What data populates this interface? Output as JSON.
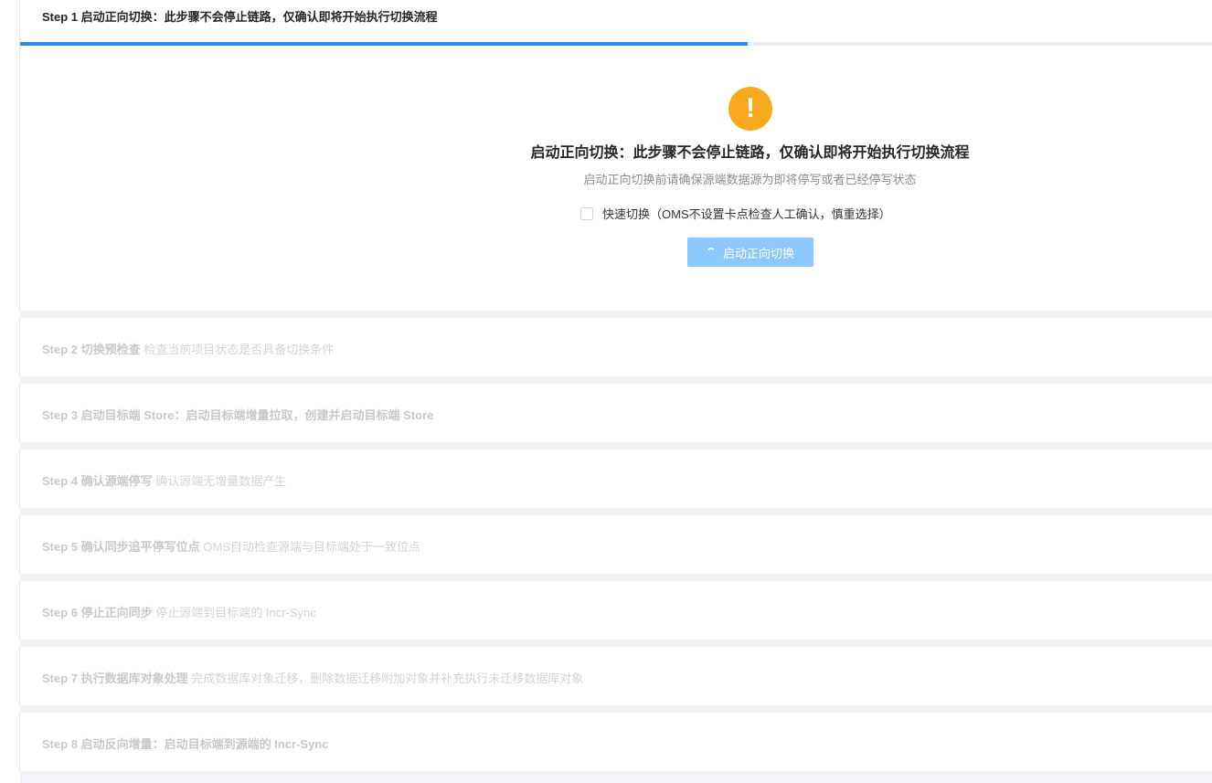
{
  "step1": {
    "header": "Step 1 启动正向切换：此步骤不会停止链路，仅确认即将开始执行切换流程",
    "progress_percent": 61,
    "warning_icon": "exclamation-icon",
    "warning_color": "#f8a91c",
    "warning_glyph": "!",
    "confirm_title": "启动正向切换：此步骤不会停止链路，仅确认即将开始执行切换流程",
    "confirm_desc": "启动正向切换前请确保源端数据源为即将停写或者已经停写状态",
    "fast_switch_label": "快速切换（OMS不设置卡点检查人工确认，慎重选择）",
    "fast_switch_checked": false,
    "start_button_label": "启动正向切换",
    "start_button_loading": true
  },
  "steps": [
    {
      "title": "Step 2 切换预检查",
      "desc": "检查当前项目状态是否具备切换条件"
    },
    {
      "title": "Step 3 启动目标端 Store：启动目标端增量拉取，创建并启动目标端 Store",
      "desc": ""
    },
    {
      "title": "Step 4 确认源端停写",
      "desc": "确认源端无增量数据产生"
    },
    {
      "title": "Step 5 确认同步追平停写位点",
      "desc": "OMS自动检查源端与目标端处于一致位点"
    },
    {
      "title": "Step 6 停止正向同步",
      "desc": "停止源端到目标端的 Incr-Sync"
    },
    {
      "title": "Step 7 执行数据库对象处理",
      "desc": "完成数据库对象迁移，删除数据迁移附加对象并补充执行未迁移数据库对象"
    },
    {
      "title": "Step 8 启动反向增量：启动目标端到源端的 Incr-Sync",
      "desc": ""
    }
  ],
  "colors": {
    "accent": "#2a8ef2",
    "button_disabled": "#8cc8fb",
    "background": "#f3f4f8"
  }
}
